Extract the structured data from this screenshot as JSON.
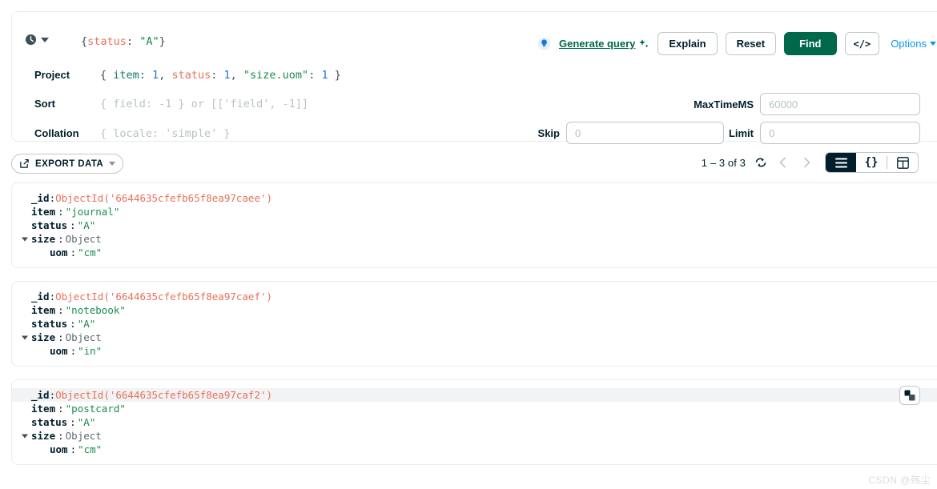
{
  "query_bar": {
    "history_icon": "clock-icon",
    "filter": {
      "open": "{",
      "key": "status",
      "colon": ": ",
      "value": "\"A\"",
      "close": "}"
    },
    "rows": [
      {
        "label": "Project",
        "value": "{ item: 1, status: 1, \"size.uom\": 1 }",
        "is_placeholder": false
      },
      {
        "label": "Sort",
        "value": "{ field: -1 } or [['field', -1]]",
        "is_placeholder": true
      },
      {
        "label": "Collation",
        "value": "{ locale: 'simple' }",
        "is_placeholder": true
      }
    ],
    "actions": {
      "bulb_icon": "lightbulb-icon",
      "generate_query_label": "Generate query",
      "sparkle_icon": "sparkle-icon",
      "explain_label": "Explain",
      "reset_label": "Reset",
      "find_label": "Find",
      "code_label": "</>",
      "options_label": "Options"
    },
    "fields": {
      "maxtimems_label": "MaxTimeMS",
      "maxtimems_value": "",
      "maxtimems_placeholder": "60000",
      "skip_label": "Skip",
      "skip_value": "",
      "skip_placeholder": "0",
      "limit_label": "Limit",
      "limit_value": "",
      "limit_placeholder": "0"
    }
  },
  "toolbar": {
    "export_label": "EXPORT DATA",
    "export_icon": "export-icon",
    "count_text": "1 – 3 of 3",
    "refresh_icon": "refresh-icon",
    "prev_icon": "chevron-left-icon",
    "next_icon": "chevron-right-icon",
    "views": [
      {
        "name": "list",
        "glyph": "list-icon",
        "active": true
      },
      {
        "name": "json",
        "glyph": "{}",
        "active": false
      },
      {
        "name": "table",
        "glyph": "table-icon",
        "active": false
      }
    ]
  },
  "documents": [
    {
      "hovered": false,
      "fields": [
        {
          "key": "_id",
          "value": "ObjectId('6644635cfefb65f8ea97caee')",
          "type": "oid",
          "indent": 0,
          "expandable": false,
          "compact_sep": true
        },
        {
          "key": "item",
          "value": "\"journal\"",
          "type": "string",
          "indent": 0,
          "expandable": false
        },
        {
          "key": "status",
          "value": "\"A\"",
          "type": "string",
          "indent": 0,
          "expandable": false
        },
        {
          "key": "size",
          "value": "Object",
          "type": "object",
          "indent": 0,
          "expandable": true
        },
        {
          "key": "uom",
          "value": "\"cm\"",
          "type": "string",
          "indent": 1,
          "expandable": false
        }
      ]
    },
    {
      "hovered": false,
      "fields": [
        {
          "key": "_id",
          "value": "ObjectId('6644635cfefb65f8ea97caef')",
          "type": "oid",
          "indent": 0,
          "expandable": false,
          "compact_sep": true
        },
        {
          "key": "item",
          "value": "\"notebook\"",
          "type": "string",
          "indent": 0,
          "expandable": false
        },
        {
          "key": "status",
          "value": "\"A\"",
          "type": "string",
          "indent": 0,
          "expandable": false
        },
        {
          "key": "size",
          "value": "Object",
          "type": "object",
          "indent": 0,
          "expandable": true
        },
        {
          "key": "uom",
          "value": "\"in\"",
          "type": "string",
          "indent": 1,
          "expandable": false
        }
      ]
    },
    {
      "hovered": true,
      "copy_icon": "copy-document-icon",
      "fields": [
        {
          "key": "_id",
          "value": "ObjectId('6644635cfefb65f8ea97caf2')",
          "type": "oid",
          "indent": 0,
          "expandable": false,
          "compact_sep": true,
          "highlight": true
        },
        {
          "key": "item",
          "value": "\"postcard\"",
          "type": "string",
          "indent": 0,
          "expandable": false
        },
        {
          "key": "status",
          "value": "\"A\"",
          "type": "string",
          "indent": 0,
          "expandable": false
        },
        {
          "key": "size",
          "value": "Object",
          "type": "object",
          "indent": 0,
          "expandable": true
        },
        {
          "key": "uom",
          "value": "\"cm\"",
          "type": "string",
          "indent": 1,
          "expandable": false
        }
      ]
    }
  ],
  "watermark": "CSDN @殇尘",
  "colors": {
    "brand_green": "#00684A",
    "link_blue": "#0498EC",
    "value_string": "#1C8C4E",
    "value_objectid": "#E8705A",
    "value_number": "#1877D2",
    "text_primary": "#001E2B",
    "border": "#E8EDEB",
    "active_toggle": "#001E2B"
  }
}
